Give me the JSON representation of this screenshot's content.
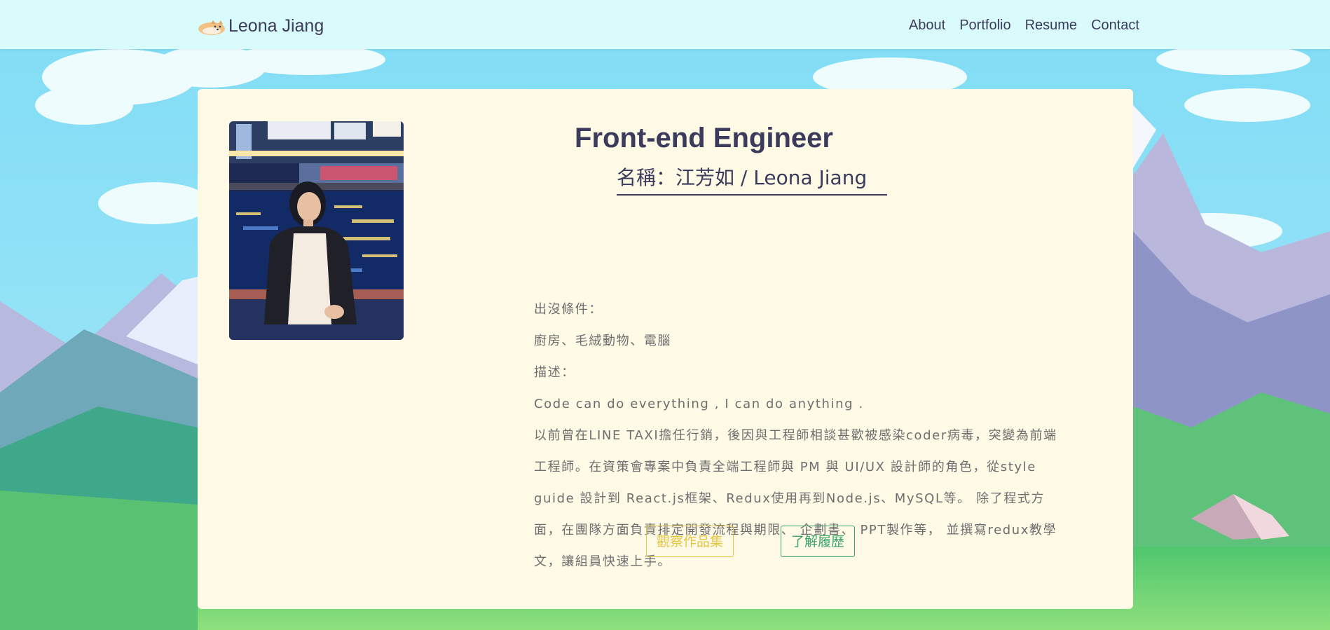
{
  "navbar": {
    "brand_name": "Leona Jiang",
    "brand_icon": "shiba-dog-icon",
    "links": [
      "About",
      "Portfolio",
      "Resume",
      "Contact"
    ]
  },
  "profile": {
    "title": "Front-end Engineer",
    "subtitle": "名稱：江芳如 / Leona Jiang",
    "appear_label": "出沒條件：",
    "appear_value": "廚房、毛絨動物、電腦",
    "desc_label": "描述：",
    "motto": "Code can do everything , I can do anything .",
    "description": "以前曾在LINE TAXI擔任行銷，後因與工程師相談甚歡被感染coder病毒，突變為前端工程師。在資策會專案中負責全端工程師與 PM 與 UI/UX 設計師的角色，從style guide 設計到 React.js框架、Redux使用再到Node.js、MySQL等。 除了程式方面，在團隊方面負責排定開發流程與期限、 企劃書、 PPT製作等， 並撰寫redux教學文，讓組員快速上手。"
  },
  "buttons": {
    "portfolio": "觀察作品集",
    "resume": "了解履歷"
  },
  "colors": {
    "navbar_bg": "#d9fbfb",
    "card_bg": "#fefae6",
    "text_dark": "#3b3b5c",
    "text_body": "#6e6e6e",
    "accent_yellow": "#e5c646",
    "accent_green": "#3aa56a"
  }
}
